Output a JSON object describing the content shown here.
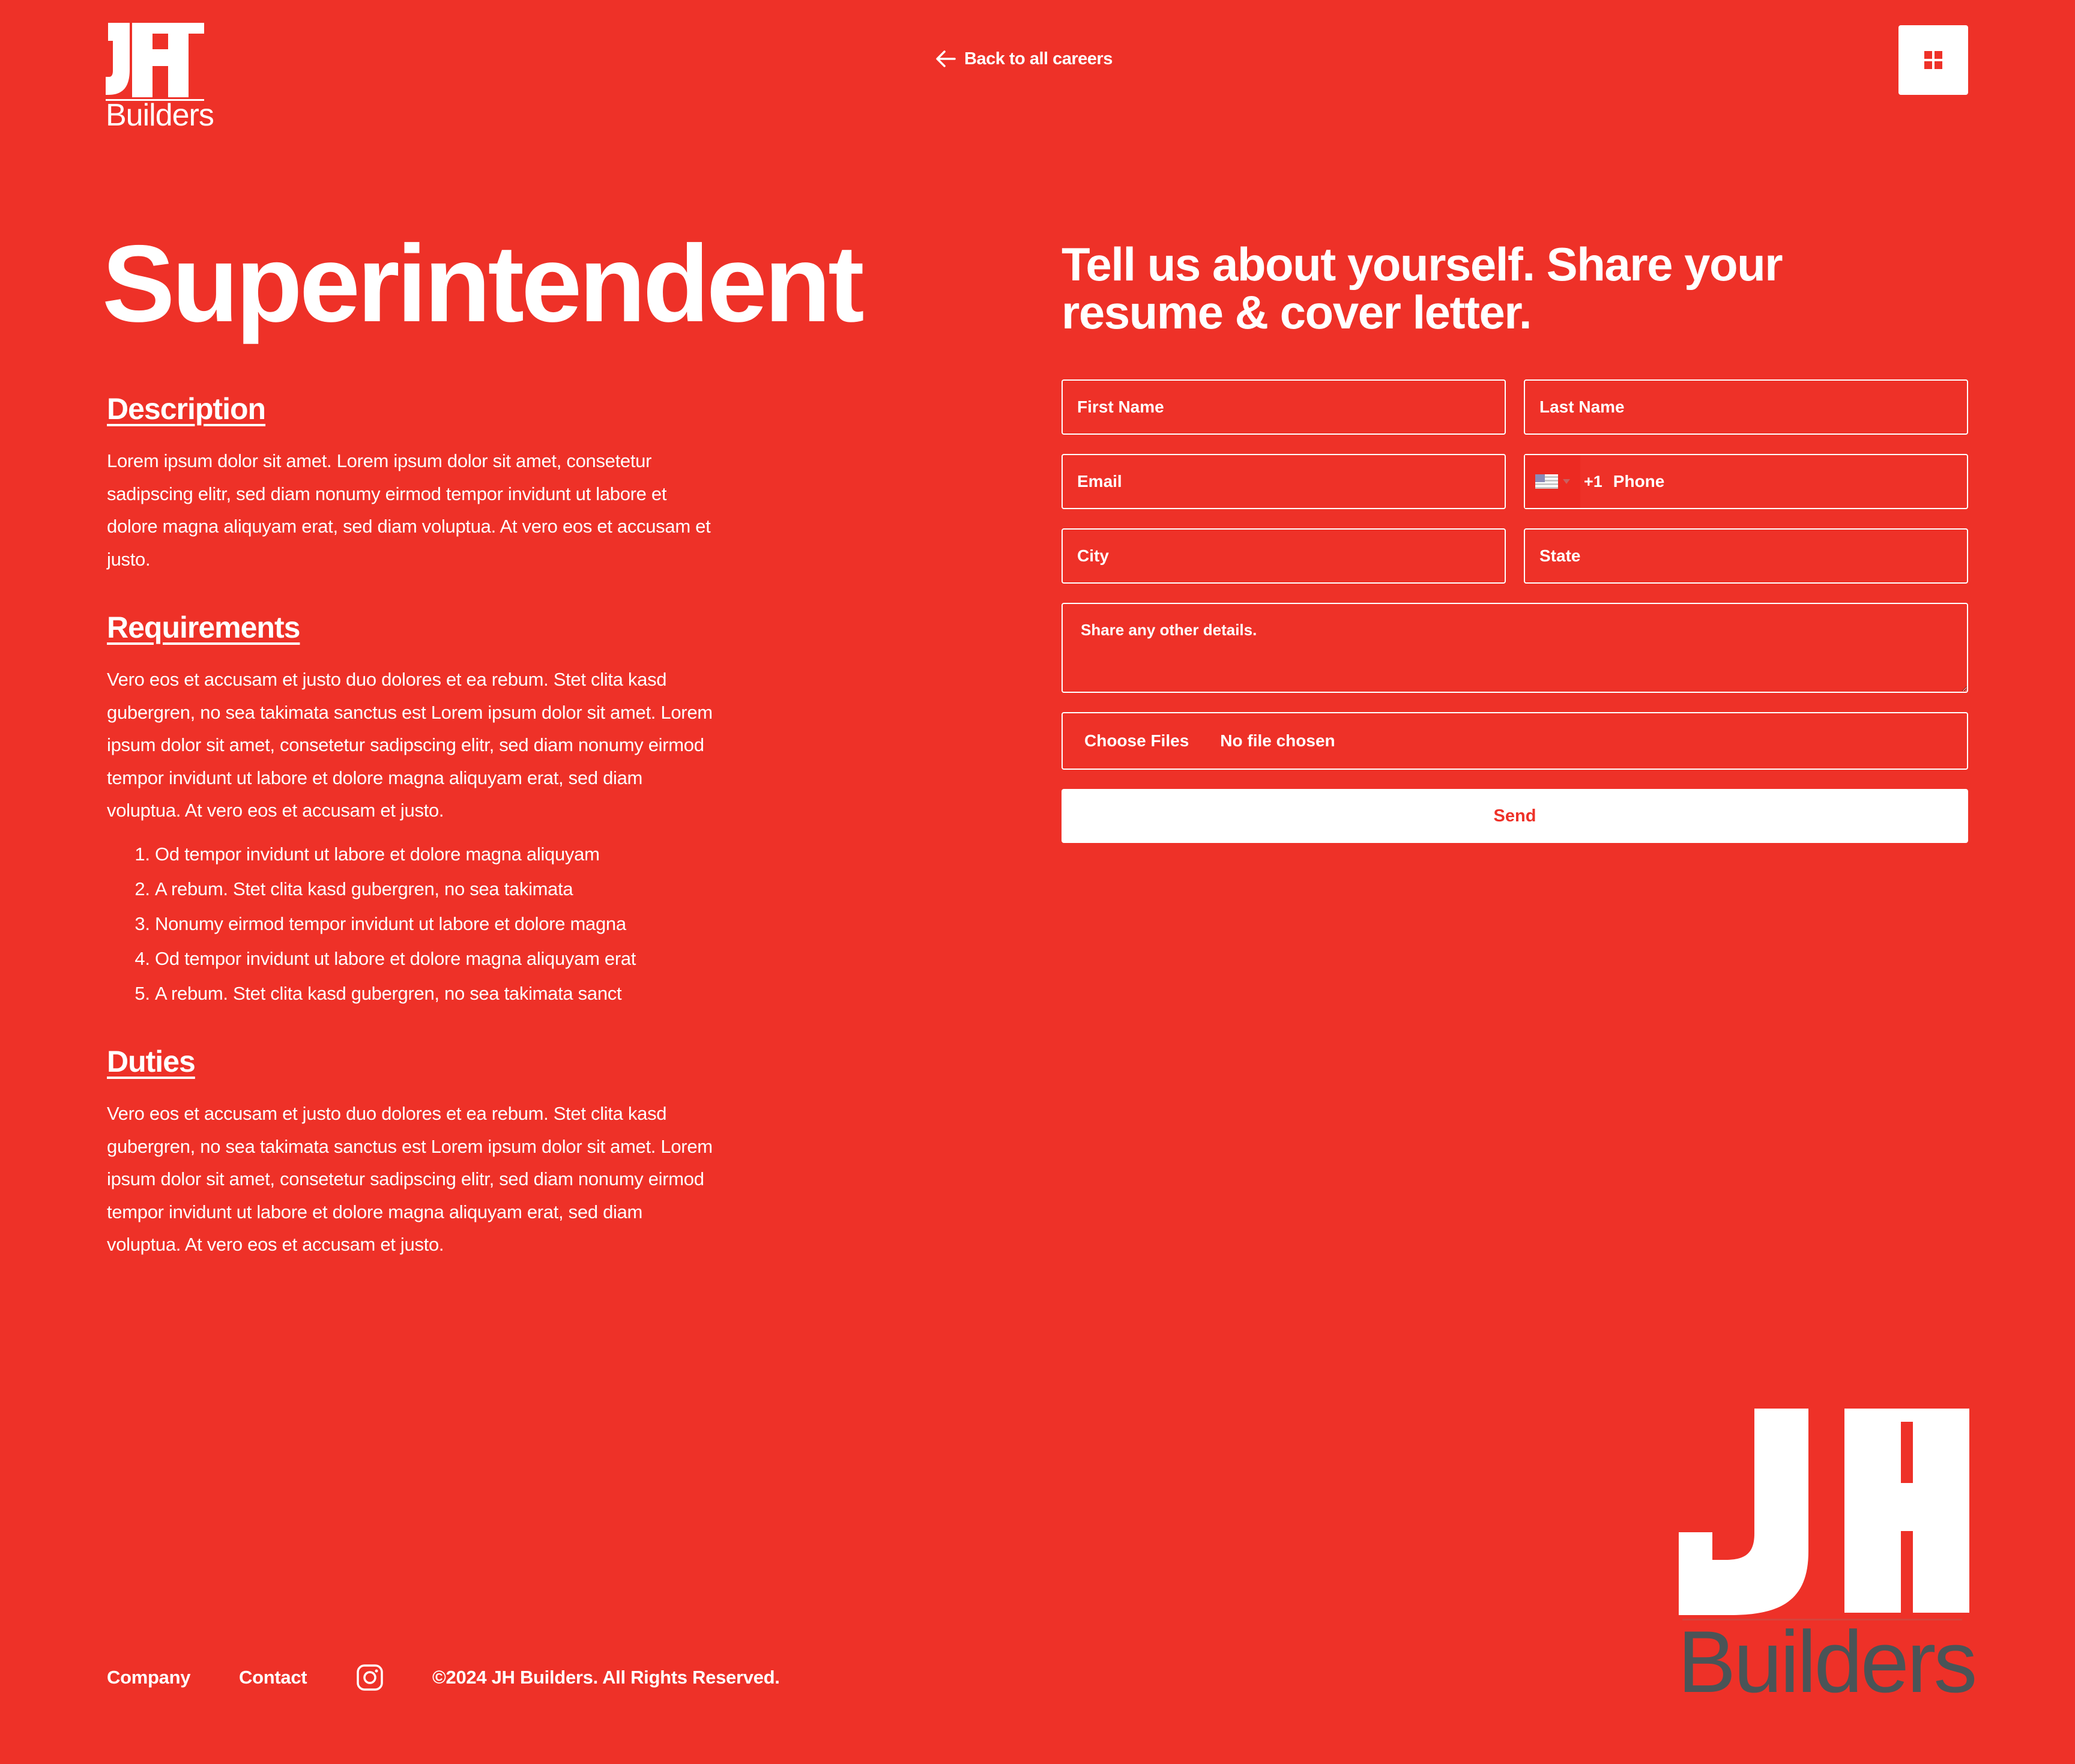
{
  "header": {
    "logo": {
      "mark": "JH",
      "word": "Builders"
    },
    "back_link": "Back to all careers",
    "menu_icon": "grid-icon"
  },
  "job": {
    "title": "Superintendent",
    "description_heading": "Description",
    "description_text": "Lorem ipsum dolor sit amet. Lorem ipsum dolor sit amet, consetetur sadipscing elitr, sed diam nonumy eirmod tempor invidunt ut labore et dolore magna aliquyam erat, sed diam voluptua. At vero eos et accusam et justo.",
    "requirements_heading": "Requirements",
    "requirements_text": "Vero eos et accusam et justo duo dolores et ea rebum. Stet clita kasd gubergren, no sea takimata sanctus est Lorem ipsum dolor sit amet. Lorem ipsum dolor sit amet, consetetur sadipscing elitr, sed diam nonumy eirmod tempor invidunt ut labore et dolore magna aliquyam erat, sed diam voluptua. At vero eos et accusam et justo.",
    "requirements_list": [
      "Od tempor invidunt ut labore et dolore magna aliquyam",
      "A rebum. Stet clita kasd gubergren, no sea takimata",
      "Nonumy eirmod tempor invidunt ut labore et dolore magna",
      "Od tempor invidunt ut labore et dolore magna aliquyam erat",
      "A rebum. Stet clita kasd gubergren, no sea takimata sanct"
    ],
    "duties_heading": "Duties",
    "duties_text": "Vero eos et accusam et justo duo dolores et ea rebum. Stet clita kasd gubergren, no sea takimata sanctus est Lorem ipsum dolor sit amet. Lorem ipsum dolor sit amet, consetetur sadipscing elitr, sed diam nonumy eirmod tempor invidunt ut labore et dolore magna aliquyam erat, sed diam voluptua. At vero eos et accusam et justo."
  },
  "form": {
    "title": "Tell us about yourself. Share your resume & cover letter.",
    "first_name": {
      "placeholder": "First Name",
      "value": ""
    },
    "last_name": {
      "placeholder": "Last Name",
      "value": ""
    },
    "email": {
      "placeholder": "Email",
      "value": ""
    },
    "phone": {
      "dial_code": "+1",
      "placeholder": "Phone",
      "value": "",
      "flag_icon": "us-flag-icon"
    },
    "city": {
      "placeholder": "City",
      "value": ""
    },
    "state": {
      "placeholder": "State",
      "value": ""
    },
    "details": {
      "placeholder": "Share any other details.",
      "value": ""
    },
    "file": {
      "button": "Choose Files",
      "status": "No file chosen"
    },
    "send": "Send"
  },
  "footer": {
    "company": "Company",
    "contact": "Contact",
    "instagram_icon": "instagram-icon",
    "copyright": "©2024 JH Builders. All Rights Reserved.",
    "logo": {
      "mark": "JH",
      "word": "Builders"
    }
  },
  "colors": {
    "background": "#ee3128",
    "text": "#ffffff",
    "logo_gray": "#4a5457"
  }
}
